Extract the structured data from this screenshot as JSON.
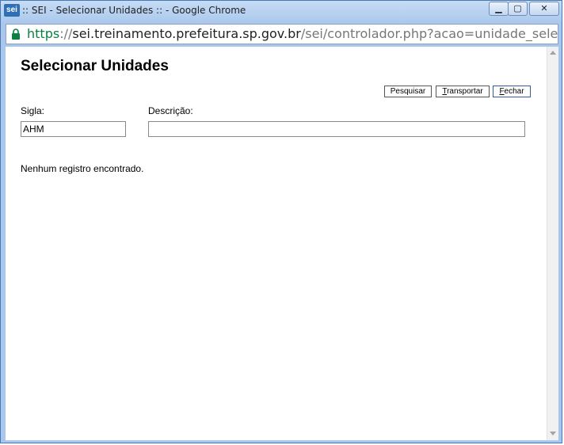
{
  "window": {
    "title": ":: SEI - Selecionar Unidades :: - Google Chrome",
    "logo_text": "sei",
    "controls": {
      "minimize": "▁",
      "maximize": "▢",
      "close": "✕"
    }
  },
  "addressbar": {
    "scheme": "https",
    "separator": "://",
    "host": "sei.treinamento.prefeitura.sp.gov.br",
    "path": "/sei/controlador.php?acao=unidade_selecionar_envi"
  },
  "page": {
    "title": "Selecionar Unidades",
    "buttons": {
      "pesquisar": "Pesquisar",
      "transportar_key": "T",
      "transportar_rest": "ransportar",
      "fechar_key": "F",
      "fechar_rest": "echar"
    },
    "form": {
      "sigla_label": "Sigla:",
      "sigla_value": "AHM",
      "descricao_label": "Descrição:",
      "descricao_value": ""
    },
    "empty_message": "Nenhum registro encontrado."
  },
  "icons": {
    "lock": "lock-icon",
    "logo": "sei-logo"
  },
  "colors": {
    "secure_green": "#0b8043",
    "titlebar": "#a9c7ec",
    "focus_border": "#2f5ea3"
  }
}
